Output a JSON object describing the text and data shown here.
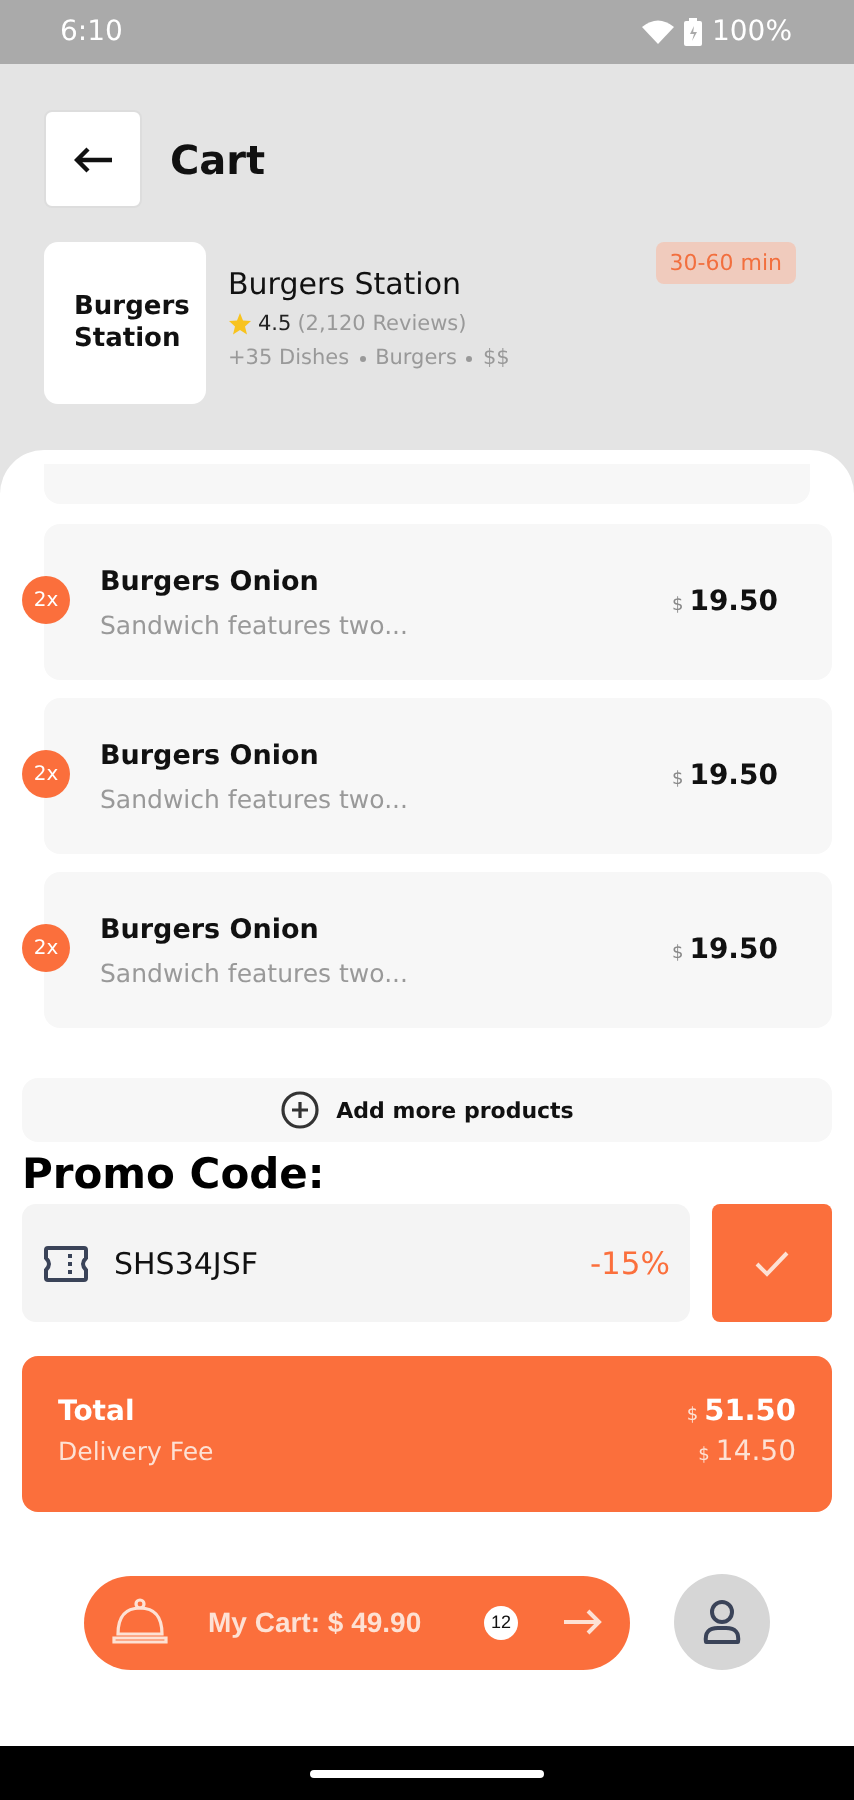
{
  "status_bar": {
    "time": "6:10",
    "battery": "100%"
  },
  "header": {
    "title": "Cart"
  },
  "restaurant": {
    "logo_text": "Burgers Station",
    "name": "Burgers Station",
    "rating": "4.5",
    "reviews": "(2,120 Reviews)",
    "tags": [
      "+35 Dishes",
      "Burgers",
      "$$"
    ],
    "delivery_time": "30-60 min"
  },
  "items": [
    {
      "quantity": "2x",
      "name": "Burgers Onion",
      "description": "Sandwich features two...",
      "currency": "$",
      "price": "19.50"
    },
    {
      "quantity": "2x",
      "name": "Burgers Onion",
      "description": "Sandwich features two...",
      "currency": "$",
      "price": "19.50"
    },
    {
      "quantity": "2x",
      "name": "Burgers Onion",
      "description": "Sandwich features two...",
      "currency": "$",
      "price": "19.50"
    }
  ],
  "add_more": {
    "label": "Add more products"
  },
  "promo": {
    "title": "Promo Code:",
    "code": "SHS34JSF",
    "discount": "-15%"
  },
  "summary": {
    "total_label": "Total",
    "total_currency": "$",
    "total": "51.50",
    "fee_label": "Delivery Fee",
    "fee_currency": "$",
    "fee": "14.50"
  },
  "cart_bar": {
    "label": "My Cart: $ 49.90",
    "count": "12"
  }
}
